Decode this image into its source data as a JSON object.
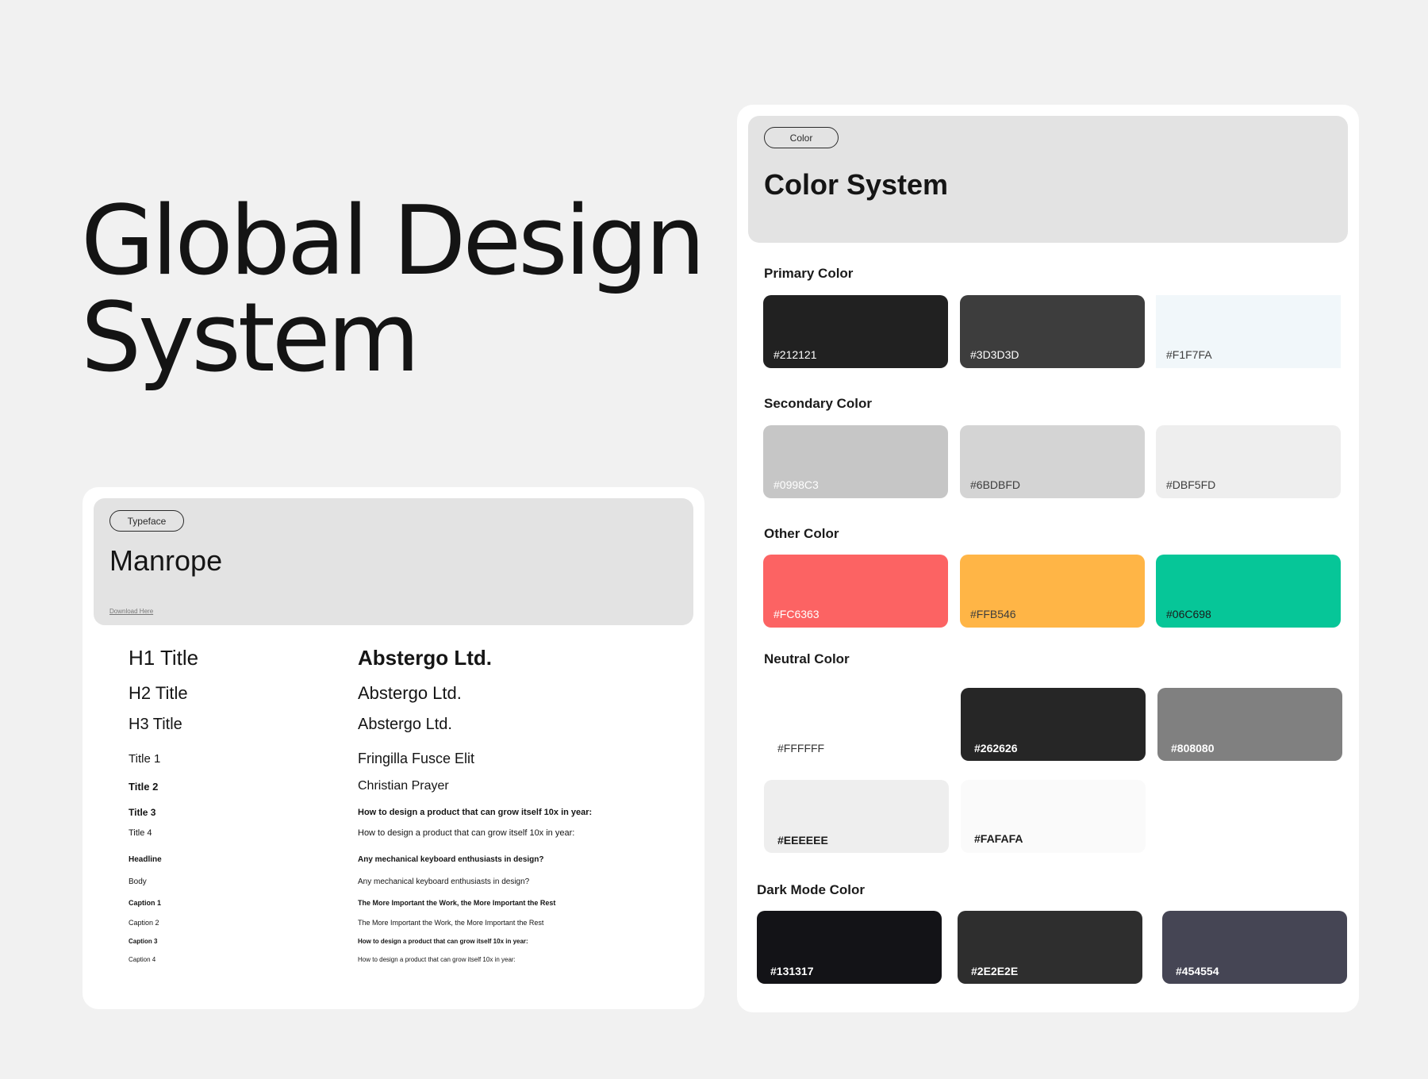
{
  "hero": {
    "line1": "Global Design",
    "line2": "System"
  },
  "typeface": {
    "tag": "Typeface",
    "name": "Manrope",
    "download": "Download Here",
    "rows": [
      {
        "label": "H1 Title",
        "sample": "Abstergo Ltd."
      },
      {
        "label": "H2 Title",
        "sample": "Abstergo Ltd."
      },
      {
        "label": "H3 Title",
        "sample": "Abstergo Ltd."
      },
      {
        "label": "Title 1",
        "sample": "Fringilla Fusce Elit"
      },
      {
        "label": "Title 2",
        "sample": "Christian Prayer"
      },
      {
        "label": "Title 3",
        "sample": "How to design a product that can grow itself 10x in year:"
      },
      {
        "label": "Title 4",
        "sample": "How to design a product that can grow itself 10x in year:"
      },
      {
        "label": "Headline",
        "sample": "Any mechanical keyboard enthusiasts in design?"
      },
      {
        "label": "Body",
        "sample": "Any mechanical keyboard enthusiasts in design?"
      },
      {
        "label": "Caption 1",
        "sample": "The More Important the Work, the More Important the Rest"
      },
      {
        "label": "Caption 2",
        "sample": "The More Important the Work, the More Important the Rest"
      },
      {
        "label": "Caption 3",
        "sample": "How to design a product that can grow itself 10x in year:"
      },
      {
        "label": "Caption 4",
        "sample": "How to design a product that can grow itself 10x in year:"
      }
    ]
  },
  "color_system": {
    "tag": "Color",
    "title": "Color System",
    "primary": {
      "label": "Primary Color",
      "swatches": [
        {
          "hex": "#212121",
          "color": "#212121",
          "text": "#ffffff"
        },
        {
          "hex": "#3D3D3D",
          "color": "#3D3D3D",
          "text": "#ffffff"
        },
        {
          "hex": "#F1F7FA",
          "color": "#F1F7FA",
          "text": "#3d3d3d"
        }
      ]
    },
    "secondary": {
      "label": "Secondary Color",
      "swatches": [
        {
          "hex": "#0998C3",
          "color": "#C6C6C6",
          "text": "#ffffff"
        },
        {
          "hex": "#6BDBFD",
          "color": "#D4D4D4",
          "text": "#3d3d3d"
        },
        {
          "hex": "#DBF5FD",
          "color": "#EEEEEE",
          "text": "#3d3d3d"
        }
      ]
    },
    "other": {
      "label": "Other Color",
      "swatches": [
        {
          "hex": "#FC6363",
          "color": "#FC6363",
          "text": "#ffffff"
        },
        {
          "hex": "#FFB546",
          "color": "#FFB546",
          "text": "#3d3d3d"
        },
        {
          "hex": "#06C698",
          "color": "#06C698",
          "text": "#1b1b1b"
        }
      ]
    },
    "neutral": {
      "label": "Neutral Color",
      "swatches": [
        {
          "hex": "#FFFFFF",
          "color": "#FFFFFF",
          "text": "#333333"
        },
        {
          "hex": "#262626",
          "color": "#262626",
          "text": "#ffffff"
        },
        {
          "hex": "#808080",
          "color": "#808080",
          "text": "#ffffff"
        },
        {
          "hex": "#EEEEEE",
          "color": "#EEEEEE",
          "text": "#1b1b1b"
        },
        {
          "hex": "#FAFAFA",
          "color": "#FAFAFA",
          "text": "#1b1b1b"
        }
      ]
    },
    "dark": {
      "label": "Dark Mode Color",
      "swatches": [
        {
          "hex": "#131317",
          "color": "#131317",
          "text": "#ffffff"
        },
        {
          "hex": "#2E2E2E",
          "color": "#2E2E2E",
          "text": "#ffffff"
        },
        {
          "hex": "#454554",
          "color": "#454554",
          "text": "#ffffff"
        }
      ]
    }
  }
}
